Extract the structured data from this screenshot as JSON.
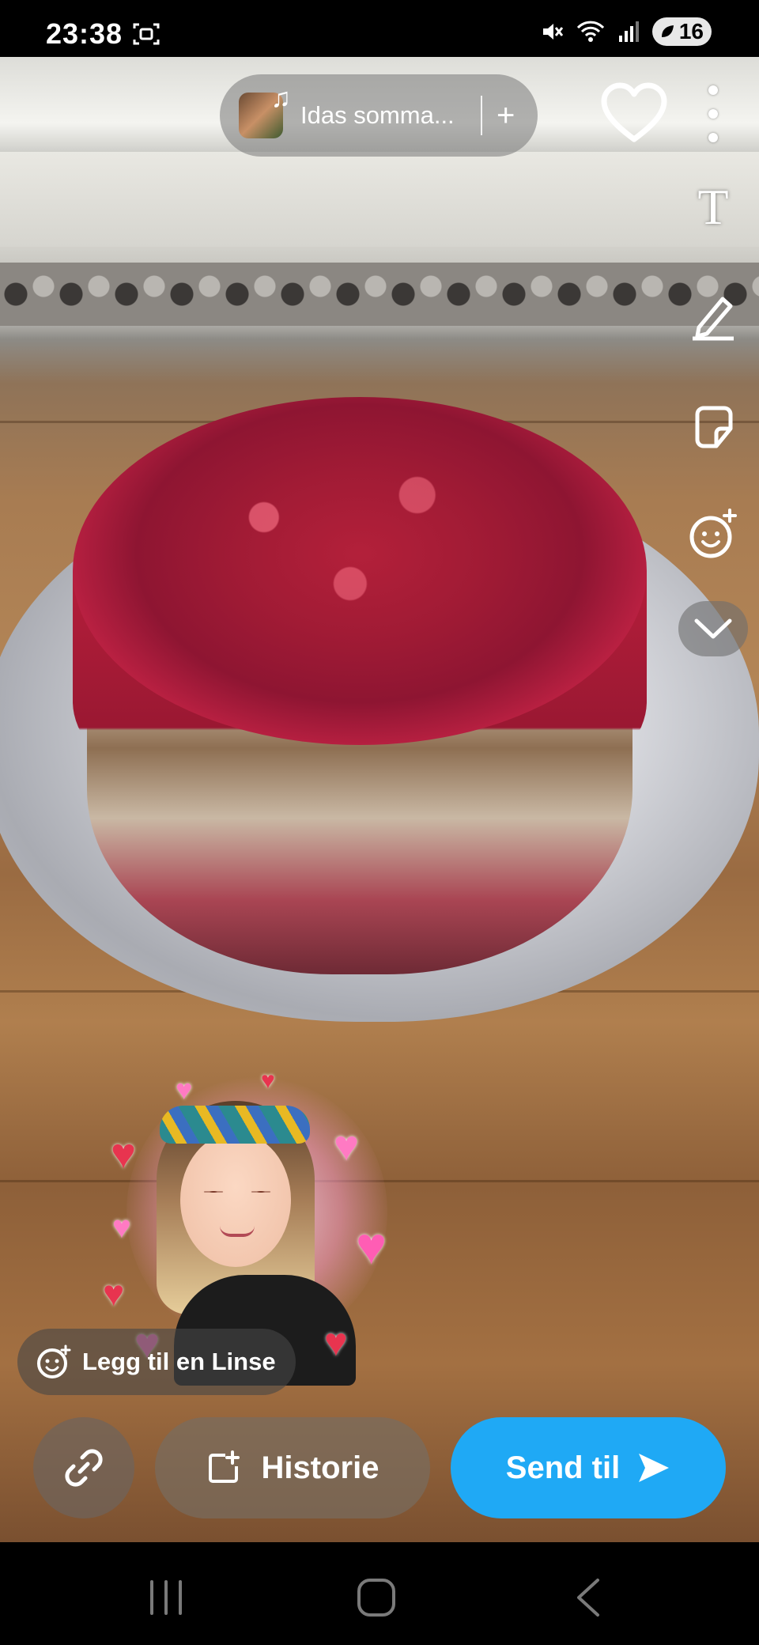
{
  "status_bar": {
    "time": "23:38",
    "battery": "16",
    "icons": [
      "screen-record-icon",
      "mute-icon",
      "wifi-icon",
      "signal-icon",
      "battery-saver-icon"
    ]
  },
  "sound": {
    "title": "Idas somma...",
    "add_symbol": "+"
  },
  "tools": {
    "text_tool_symbol": "T",
    "icons": [
      "text-icon",
      "pen-icon",
      "sticker-icon",
      "lens-face-icon",
      "chevron-down-icon"
    ]
  },
  "bottom": {
    "lens_label": "Legg til en Linse",
    "story_label": "Historie",
    "send_label": "Send til"
  },
  "colors": {
    "send_button": "#1fa9f5",
    "pill_background": "rgba(120,120,120,0.55)"
  },
  "nav": {
    "icons": [
      "recents-icon",
      "home-icon",
      "back-icon"
    ]
  }
}
